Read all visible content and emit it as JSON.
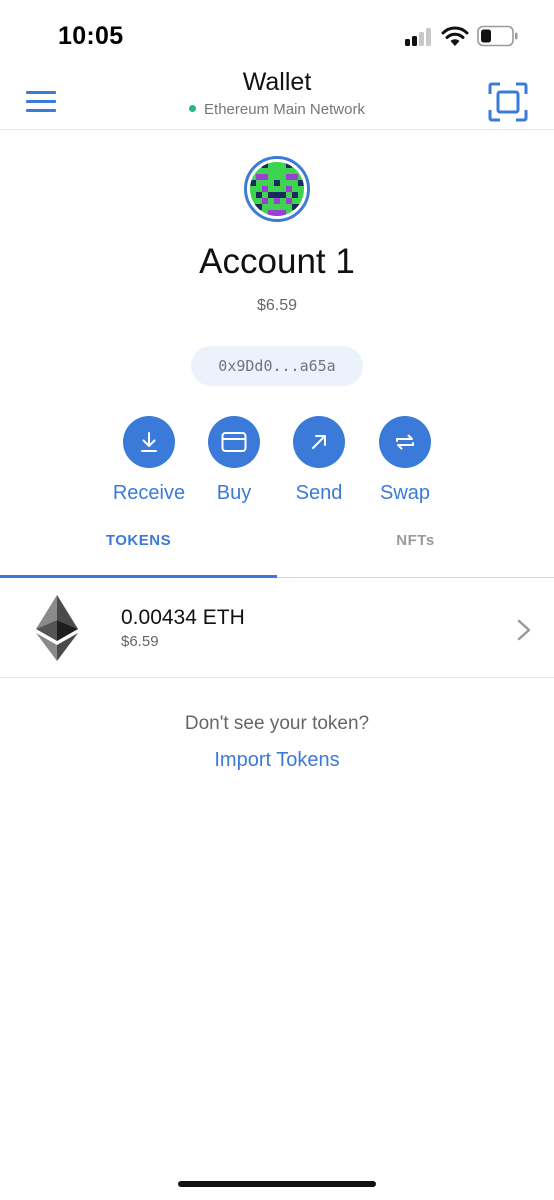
{
  "status_bar": {
    "time": "10:05"
  },
  "header": {
    "title": "Wallet",
    "network": "Ethereum Main Network",
    "network_status_color": "#29b67f"
  },
  "account": {
    "name": "Account 1",
    "balance": "$6.59",
    "address": "0x9Dd0...a65a"
  },
  "actions": [
    {
      "label": "Receive",
      "icon": "download-icon"
    },
    {
      "label": "Buy",
      "icon": "card-icon"
    },
    {
      "label": "Send",
      "icon": "arrow-up-right-icon"
    },
    {
      "label": "Swap",
      "icon": "swap-icon"
    }
  ],
  "tabs": [
    {
      "label": "TOKENS",
      "active": true
    },
    {
      "label": "NFTs",
      "active": false
    }
  ],
  "tokens": [
    {
      "amount": "0.00434 ETH",
      "fiat": "$6.59",
      "icon": "ethereum-icon"
    }
  ],
  "import": {
    "prompt": "Don't see your token?",
    "link_label": "Import Tokens"
  },
  "colors": {
    "accent": "#3b7ad9",
    "muted_text": "#666666",
    "pill_bg": "#ebf2fc"
  }
}
